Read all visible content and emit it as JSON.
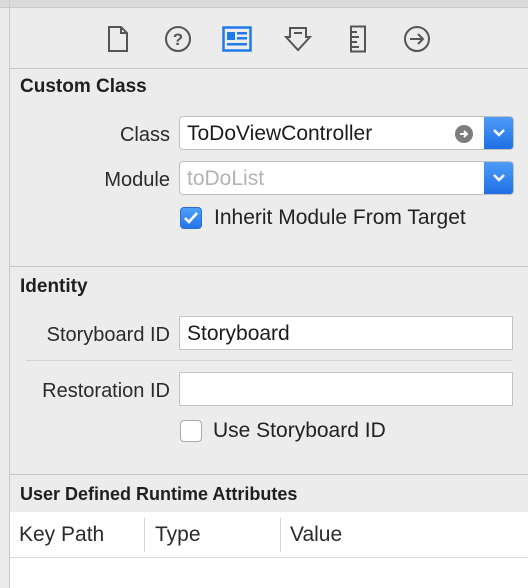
{
  "toolbar": {
    "tabs": [
      {
        "icon": "file-inspector-icon",
        "selected": false
      },
      {
        "icon": "quick-help-icon",
        "selected": false
      },
      {
        "icon": "identity-inspector-icon",
        "selected": true
      },
      {
        "icon": "attributes-inspector-icon",
        "selected": false
      },
      {
        "icon": "size-inspector-icon",
        "selected": false
      },
      {
        "icon": "connections-inspector-icon",
        "selected": false
      }
    ],
    "accent_color": "#1f7aec"
  },
  "custom_class": {
    "title": "Custom Class",
    "class_label": "Class",
    "class_value": "ToDoViewController",
    "module_label": "Module",
    "module_placeholder": "toDoList",
    "inherit_label": "Inherit Module From Target",
    "inherit_checked": true
  },
  "identity": {
    "title": "Identity",
    "storyboard_id_label": "Storyboard ID",
    "storyboard_id_value": "Storyboard",
    "restoration_id_label": "Restoration ID",
    "restoration_id_value": "",
    "use_storyboard_label": "Use Storyboard ID",
    "use_storyboard_checked": false
  },
  "runtime_attributes": {
    "title": "User Defined Runtime Attributes",
    "columns": [
      "Key Path",
      "Type",
      "Value"
    ]
  }
}
